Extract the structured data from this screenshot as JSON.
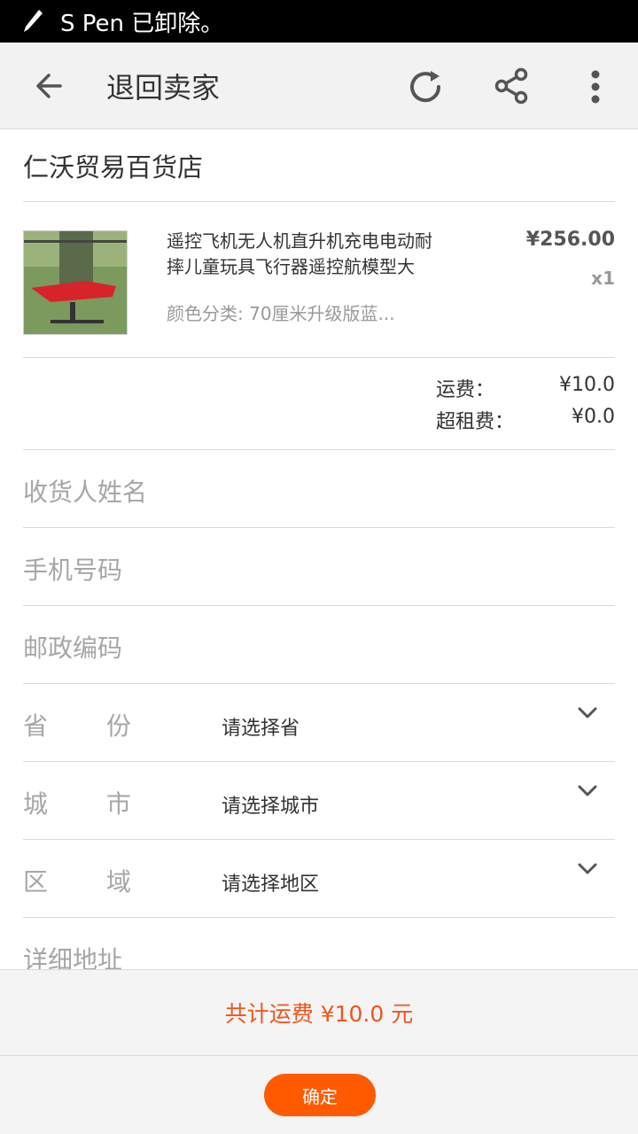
{
  "status_bar": {
    "text": "S Pen 已卸除。",
    "icon": "pen-icon"
  },
  "app_bar": {
    "title": "退回卖家",
    "icons": [
      "back-arrow-icon",
      "refresh-icon",
      "share-icon",
      "more-vert-icon"
    ],
    "background": "#f2f2f2"
  },
  "shop": {
    "name": "仁沃贸易百货店"
  },
  "product": {
    "name": "遥控飞机无人机直升机充电电动耐摔儿童玩具飞行器遥控航模型大",
    "spec": "颜色分类: 70厘米升级版蓝...",
    "price": "¥256.00",
    "quantity": "x1"
  },
  "fees": [
    {
      "label": "运费：",
      "value": "¥10.0"
    },
    {
      "label": "超租费：",
      "value": "¥0.0"
    }
  ],
  "form": {
    "name_placeholder": "收货人姓名",
    "phone_placeholder": "手机号码",
    "zip_placeholder": "邮政编码",
    "province": {
      "label1": "省",
      "label2": "份",
      "value": "请选择省"
    },
    "city": {
      "label1": "城",
      "label2": "市",
      "value": "请选择城市"
    },
    "region": {
      "label1": "区",
      "label2": "域",
      "value": "请选择地区"
    },
    "address_placeholder": "详细地址"
  },
  "summary": {
    "text": "共计运费 ¥10.0 元",
    "color": "#f0551e"
  },
  "footer": {
    "confirm_label": "确定",
    "button_color": "#ff5a00"
  }
}
